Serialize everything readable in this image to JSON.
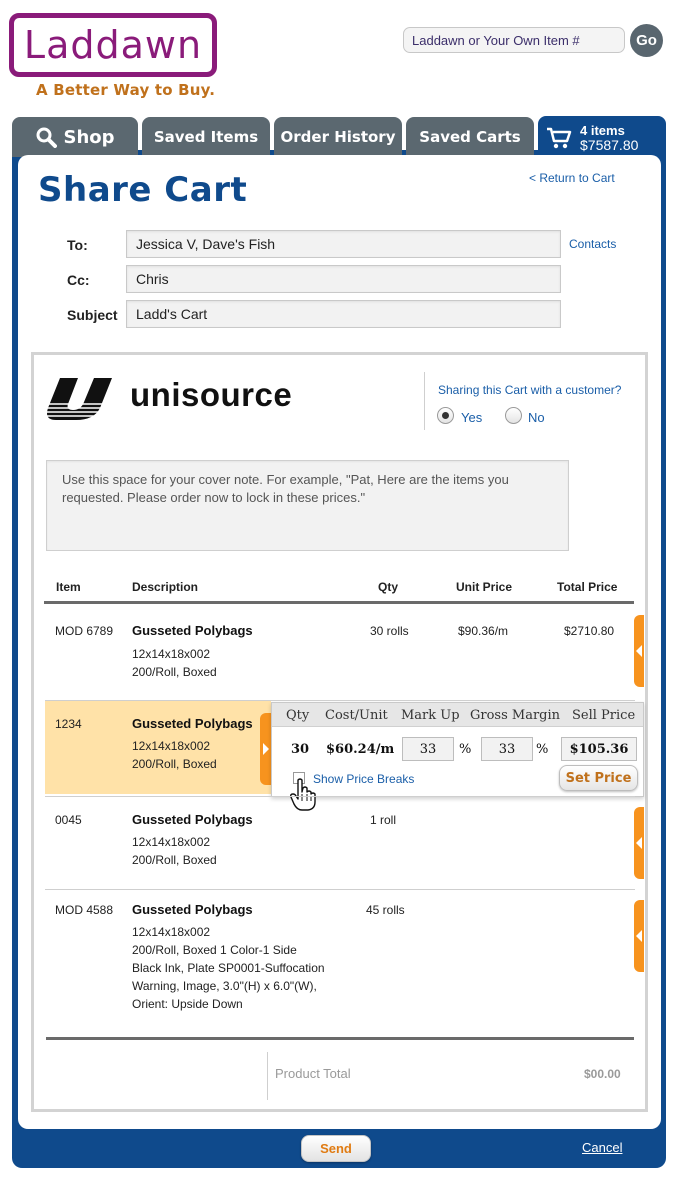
{
  "header": {
    "logo_text": "Laddawn",
    "tagline": "A Better Way to Buy.",
    "search_placeholder": "Laddawn or Your Own Item #",
    "go_label": "Go"
  },
  "tabs": [
    {
      "label": "Shop"
    },
    {
      "label": "Saved Items"
    },
    {
      "label": "Order History"
    },
    {
      "label": "Saved Carts"
    }
  ],
  "cart": {
    "items": "4 items",
    "total": "$7587.80"
  },
  "page": {
    "title": "Share Cart",
    "return_link": "< Return to Cart"
  },
  "form": {
    "to_label": "To:",
    "to_value": "Jessica V, Dave's Fish",
    "cc_label": "Cc:",
    "cc_value": "Chris",
    "subject_label": "Subject",
    "subject_value": "Ladd's Cart",
    "contacts_link": "Contacts"
  },
  "preview": {
    "company_logo": "unisource",
    "sharing_question": "Sharing this Cart with a customer?",
    "yes_label": "Yes",
    "no_label": "No",
    "selected": "Yes",
    "cover_note_placeholder": "Use this space for your cover note. For example, \"Pat, Here are the items you requested. Please order now to lock in these prices.\""
  },
  "table": {
    "headers": [
      "Item",
      "Description",
      "Qty",
      "Unit Price",
      "Total Price"
    ],
    "rows": [
      {
        "item": "MOD 6789",
        "title": "Gusseted Polybags",
        "lines": [
          "12x14x18x002",
          "200/Roll, Boxed"
        ],
        "qty": "30 rolls",
        "unit": "$90.36/m",
        "total": "$2710.80"
      },
      {
        "item": "1234",
        "title": "Gusseted Polybags",
        "lines": [
          "12x14x18x002",
          "200/Roll, Boxed"
        ],
        "qty": "",
        "unit": "",
        "total": ""
      },
      {
        "item": "0045",
        "title": "Gusseted Polybags",
        "lines": [
          "12x14x18x002",
          "200/Roll, Boxed"
        ],
        "qty": "1 roll",
        "unit": "",
        "total": ""
      },
      {
        "item": "MOD 4588",
        "title": "Gusseted Polybags",
        "lines": [
          "12x14x18x002",
          "200/Roll, Boxed  1 Color-1 Side",
          "Black Ink, Plate SP0001-Suffocation",
          "Warning, Image, 3.0\"(H) x 6.0\"(W),",
          "Orient: Upside Down"
        ],
        "qty": "45 rolls",
        "unit": "",
        "total": ""
      }
    ]
  },
  "price_popup": {
    "headers": [
      "Qty",
      "Cost/Unit",
      "Mark Up",
      "Gross Margin",
      "Sell Price"
    ],
    "qty": "30",
    "cost_unit": "$60.24/m",
    "markup": "33",
    "gross_margin": "33",
    "percent": "%",
    "sell_price": "$105.36",
    "show_price_breaks": "Show Price Breaks",
    "set_price_label": "Set Price"
  },
  "totals": {
    "label": "Product Total",
    "value": "$00.00"
  },
  "footer": {
    "send_label": "Send",
    "cancel_label": "Cancel"
  },
  "colors": {
    "brand_purple": "#8a1b7a",
    "brand_blue": "#0f4a8c",
    "tab_gray": "#5b6870",
    "accent_orange": "#f7931e",
    "highlight": "#ffe2a8"
  }
}
